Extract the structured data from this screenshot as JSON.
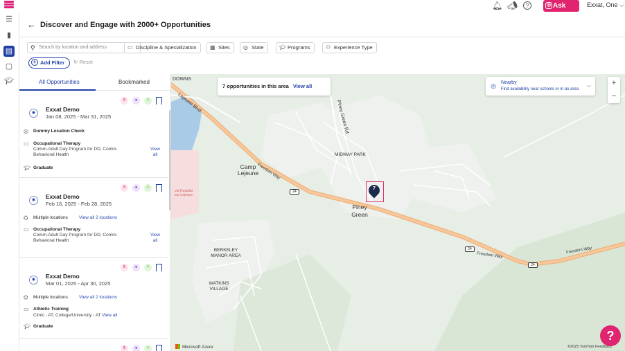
{
  "topbar": {
    "ask_leo": "Ask Leo",
    "user_name": "Exxat, One"
  },
  "header": {
    "title": "Discover and Engage with 2000+ Opportunities"
  },
  "filters": {
    "search_placeholder": "Search by location and address",
    "chips": [
      "Discipline & Specialization",
      "Sites",
      "State",
      "Programs",
      "Experience Type"
    ],
    "add_filter": "Add Filter",
    "reset": "Reset"
  },
  "tabs": [
    "All Opportunities",
    "Bookmarked"
  ],
  "cards": [
    {
      "org": "Exxat Demo",
      "dates": "Jan 08, 2025 - Mar 31, 2025",
      "location": "Dummy Location Check",
      "discipline": "Occupational Therapy",
      "detail": "Comm-Adult Day Program for DD, Comm-Behavioral Health",
      "view_all": "View all",
      "level": "Graduate"
    },
    {
      "org": "Exxat Demo",
      "dates": "Feb 16, 2025 - Feb 28, 2025",
      "location": "Multiple locations",
      "location_link": "View all 2 locations",
      "discipline": "Occupational Therapy",
      "detail": "Comm-Adult Day Program for DD, Comm-Behavioral Health",
      "view_all": "View all"
    },
    {
      "org": "Exxat Demo",
      "dates": "Mar 01, 2025 - Apr 30, 2025",
      "location": "Multiple locations",
      "location_link": "View all 2 locations",
      "discipline": "Athletic Training",
      "detail": "Clinic - AT, College/University - AT",
      "view_all": "View all",
      "level": "Graduate"
    }
  ],
  "map": {
    "count_text": "7 opportunities in this area",
    "view_all": "View all",
    "nearby_title": "Nearby",
    "nearby_sub": "Find availability near schools or in an area",
    "pin_count": "7",
    "labels": {
      "downs": "DOWNS",
      "lejeune_blvd": "Lejeune Blvd",
      "piney_green_rd": "Piney Green Rd",
      "midway_park": "MIDWAY PARK",
      "camp_lejeune": "Camp Lejeune",
      "freedom_way": "Freedom Way",
      "naval_hospital": "val Hospital mp Lejeune",
      "piney_green": "Piney Green",
      "berkeley": "BERKELEY MANOR AREA",
      "watkins": "WATKINS VILLAGE",
      "route": "24"
    },
    "attribution": "Microsoft Azure",
    "copyright": "©2025 TomTom Feedback"
  },
  "colors": {
    "brand": "#e0246f",
    "primary": "#1f3fa5",
    "road": "#f0b27a"
  }
}
